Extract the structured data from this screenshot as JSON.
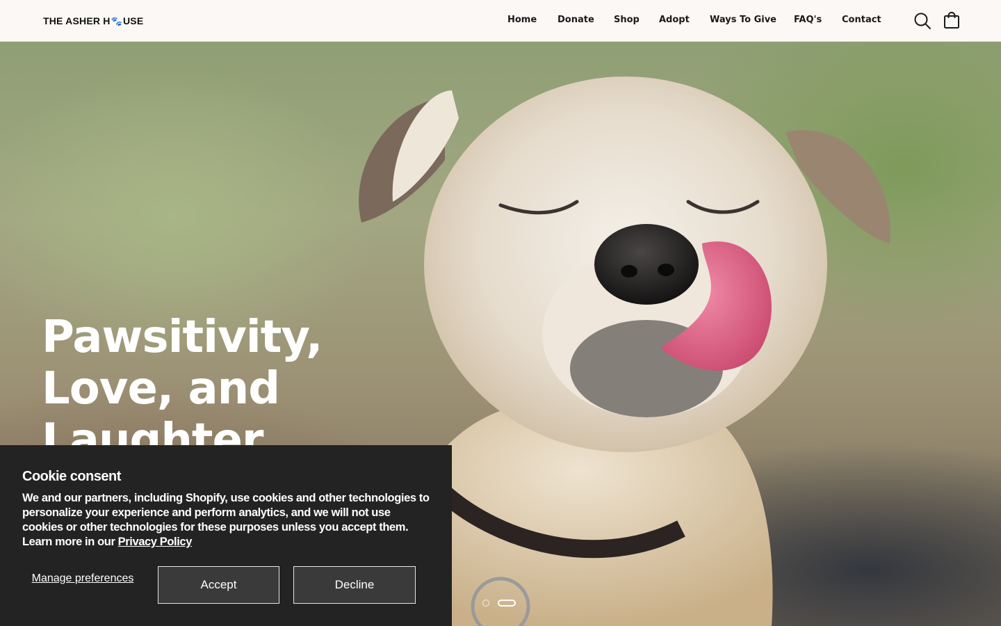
{
  "header": {
    "logo_left": "THE ASHER H",
    "logo_right": "USE",
    "nav": [
      "Home",
      "Donate",
      "Shop",
      "Adopt",
      "Ways To Give",
      "FAQ's",
      "Contact"
    ],
    "search_icon": "search-icon",
    "cart_icon": "shopping-bag-icon"
  },
  "hero": {
    "title_lines": [
      "Pawsitivity,",
      "Love, and",
      "Laughter"
    ],
    "slides_total": 2,
    "active_slide": 2
  },
  "cookie": {
    "title": "Cookie consent",
    "body": "We and our partners, including Shopify, use cookies and other technologies to personalize your experience and perform analytics, and we will not use cookies or other technologies for these purposes unless you accept them. Learn more in our ",
    "link": "Privacy Policy",
    "manage": "Manage preferences",
    "accept": "Accept",
    "decline": "Decline"
  },
  "colors": {
    "header_bg": "#fbf8f6",
    "banner_bg": "#232323",
    "button_bg": "#3a3a3a"
  }
}
